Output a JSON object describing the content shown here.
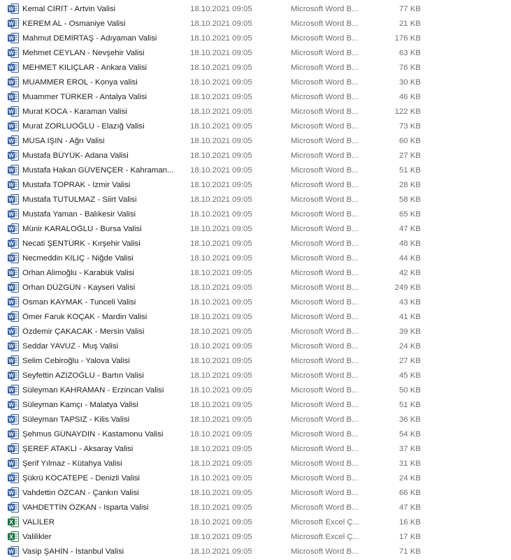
{
  "icon_colors": {
    "word": "#2b579a",
    "excel": "#217346"
  },
  "files": [
    {
      "name": "Kemal CİRİT - Artvin Valisi",
      "date": "18.10.2021 09:05",
      "type": "Microsoft Word B...",
      "size": "77 KB",
      "icon": "word-document-icon"
    },
    {
      "name": "KEREM AL - Osmaniye Valisi",
      "date": "18.10.2021 09:05",
      "type": "Microsoft Word B...",
      "size": "21 KB",
      "icon": "word-document-icon"
    },
    {
      "name": "Mahmut DEMİRTAŞ - Adıyaman Valisi",
      "date": "18.10.2021 09:05",
      "type": "Microsoft Word B...",
      "size": "176 KB",
      "icon": "word-document-icon"
    },
    {
      "name": "Mehmet CEYLAN - Nevşehir Valisi",
      "date": "18.10.2021 09:05",
      "type": "Microsoft Word B...",
      "size": "63 KB",
      "icon": "word-document-icon"
    },
    {
      "name": "MEHMET KILIÇLAR - Ankara Valisi",
      "date": "18.10.2021 09:05",
      "type": "Microsoft Word B...",
      "size": "76 KB",
      "icon": "word-document-icon"
    },
    {
      "name": "MUAMMER EROL - Konya valisi",
      "date": "18.10.2021 09:05",
      "type": "Microsoft Word B...",
      "size": "30 KB",
      "icon": "word-document-icon"
    },
    {
      "name": "Muammer TÜRKER - Antalya Valisi",
      "date": "18.10.2021 09:05",
      "type": "Microsoft Word B...",
      "size": "46 KB",
      "icon": "word-document-icon"
    },
    {
      "name": "Murat KOCA - Karaman Valisi",
      "date": "18.10.2021 09:05",
      "type": "Microsoft Word B...",
      "size": "122 KB",
      "icon": "word-document-icon"
    },
    {
      "name": "Murat ZORLUOĞLU - Elazığ Valisi",
      "date": "18.10.2021 09:05",
      "type": "Microsoft Word B...",
      "size": "73 KB",
      "icon": "word-document-icon"
    },
    {
      "name": "MUSA IŞIN - Ağrı Valisi",
      "date": "18.10.2021 09:05",
      "type": "Microsoft Word B...",
      "size": "60 KB",
      "icon": "word-document-icon"
    },
    {
      "name": "Mustafa BÜYÜK- Adana Valisi",
      "date": "18.10.2021 09:05",
      "type": "Microsoft Word B...",
      "size": "27 KB",
      "icon": "word-document-icon"
    },
    {
      "name": "Mustafa Hakan GÜVENÇER - Kahraman...",
      "date": "18.10.2021 09:05",
      "type": "Microsoft Word B...",
      "size": "51 KB",
      "icon": "word-document-icon"
    },
    {
      "name": "Mustafa TOPRAK - İzmir Valisi",
      "date": "18.10.2021 09:05",
      "type": "Microsoft Word B...",
      "size": "28 KB",
      "icon": "word-document-icon"
    },
    {
      "name": "Mustafa TUTULMAZ - Siirt Valisi",
      "date": "18.10.2021 09:05",
      "type": "Microsoft Word B...",
      "size": "58 KB",
      "icon": "word-document-icon"
    },
    {
      "name": "Mustafa Yaman - Balıkesir Valisi",
      "date": "18.10.2021 09:05",
      "type": "Microsoft Word B...",
      "size": "65 KB",
      "icon": "word-document-icon"
    },
    {
      "name": "Münir KARALOĞLU - Bursa Valisi",
      "date": "18.10.2021 09:05",
      "type": "Microsoft Word B...",
      "size": "47 KB",
      "icon": "word-document-icon"
    },
    {
      "name": "Necati ŞENTÜRK - Kırşehir Valisi",
      "date": "18.10.2021 09:05",
      "type": "Microsoft Word B...",
      "size": "48 KB",
      "icon": "word-document-icon"
    },
    {
      "name": "Necmeddin KILIÇ - Niğde Valisi",
      "date": "18.10.2021 09:05",
      "type": "Microsoft Word B...",
      "size": "44 KB",
      "icon": "word-document-icon"
    },
    {
      "name": "Orhan Alimoğlu - Karabük Valisi",
      "date": "18.10.2021 09:05",
      "type": "Microsoft Word B...",
      "size": "42 KB",
      "icon": "word-document-icon"
    },
    {
      "name": "Orhan DÜZGÜN - Kayseri Valisi",
      "date": "18.10.2021 09:05",
      "type": "Microsoft Word B...",
      "size": "249 KB",
      "icon": "word-document-icon"
    },
    {
      "name": "Osman KAYMAK - Tunceli Valisi",
      "date": "18.10.2021 09:05",
      "type": "Microsoft Word B...",
      "size": "43 KB",
      "icon": "word-document-icon"
    },
    {
      "name": "Ömer Faruk KOÇAK - Mardin Valisi",
      "date": "18.10.2021 09:05",
      "type": "Microsoft Word B...",
      "size": "41 KB",
      "icon": "word-document-icon"
    },
    {
      "name": "Özdemir ÇAKACAK - Mersin Valisi",
      "date": "18.10.2021 09:05",
      "type": "Microsoft Word B...",
      "size": "39 KB",
      "icon": "word-document-icon"
    },
    {
      "name": "Seddar YAVUZ - Muş Valisi",
      "date": "18.10.2021 09:05",
      "type": "Microsoft Word B...",
      "size": "24 KB",
      "icon": "word-document-icon"
    },
    {
      "name": "Selim Cebiroğlu - Yalova Valisi",
      "date": "18.10.2021 09:05",
      "type": "Microsoft Word B...",
      "size": "27 KB",
      "icon": "word-document-icon"
    },
    {
      "name": "Seyfettin AZİZOĞLU - Bartın Valisi",
      "date": "18.10.2021 09:05",
      "type": "Microsoft Word B...",
      "size": "45 KB",
      "icon": "word-document-icon"
    },
    {
      "name": "Süleyman KAHRAMAN - Erzincan Valisi",
      "date": "18.10.2021 09:05",
      "type": "Microsoft Word B...",
      "size": "50 KB",
      "icon": "word-document-icon"
    },
    {
      "name": "Süleyman Kamçı - Malatya Valisi",
      "date": "18.10.2021 09:05",
      "type": "Microsoft Word B...",
      "size": "51 KB",
      "icon": "word-document-icon"
    },
    {
      "name": "Süleyman TAPSIZ - Kilis Valisi",
      "date": "18.10.2021 09:05",
      "type": "Microsoft Word B...",
      "size": "36 KB",
      "icon": "word-document-icon"
    },
    {
      "name": "Şehmus GÜNAYDIN - Kastamonu Valisi",
      "date": "18.10.2021 09:05",
      "type": "Microsoft Word B...",
      "size": "54 KB",
      "icon": "word-document-icon"
    },
    {
      "name": "ŞEREF ATAKLI - Aksaray Valisi",
      "date": "18.10.2021 09:05",
      "type": "Microsoft Word B...",
      "size": "37 KB",
      "icon": "word-document-icon"
    },
    {
      "name": "Şerif Yılmaz - Kütahya Valisi",
      "date": "18.10.2021 09:05",
      "type": "Microsoft Word B...",
      "size": "31 KB",
      "icon": "word-document-icon"
    },
    {
      "name": "Şükrü KOCATEPE - Denizli Valisi",
      "date": "18.10.2021 09:05",
      "type": "Microsoft Word B...",
      "size": "24 KB",
      "icon": "word-document-icon"
    },
    {
      "name": "Vahdettin ÖZCAN - Çankırı Valisi",
      "date": "18.10.2021 09:05",
      "type": "Microsoft Word B...",
      "size": "66 KB",
      "icon": "word-document-icon"
    },
    {
      "name": "VAHDETTİN ÖZKAN - Isparta Valisi",
      "date": "18.10.2021 09:05",
      "type": "Microsoft Word B...",
      "size": "47 KB",
      "icon": "word-document-icon"
    },
    {
      "name": "VALİLER",
      "date": "18.10.2021 09:05",
      "type": "Microsoft Excel Ç...",
      "size": "16 KB",
      "icon": "excel-spreadsheet-icon"
    },
    {
      "name": "Valilikler",
      "date": "18.10.2021 09:05",
      "type": "Microsoft Excel Ç...",
      "size": "17 KB",
      "icon": "excel-spreadsheet-icon"
    },
    {
      "name": "Vasip ŞAHİN - İstanbul Valisi",
      "date": "18.10.2021 09:05",
      "type": "Microsoft Word B...",
      "size": "71 KB",
      "icon": "word-document-icon"
    }
  ]
}
